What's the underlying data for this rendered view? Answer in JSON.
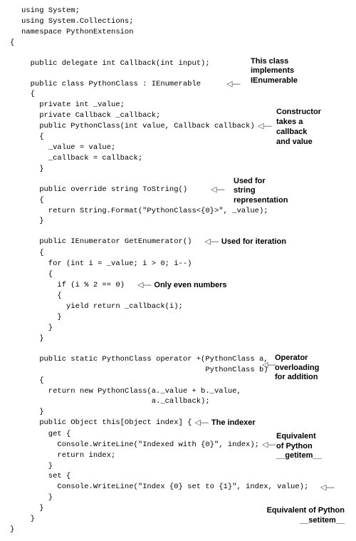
{
  "code": {
    "l01": "using System;",
    "l02": "using System.Collections;",
    "l03": "namespace PythonExtension",
    "l04": "{",
    "l05": "",
    "l06": "  public delegate int Callback(int input);",
    "l07": "",
    "l08": "  public class PythonClass : IEnumerable",
    "l09": "  {",
    "l10": "    private int _value;",
    "l11": "    private Callback _callback;",
    "l12": "    public PythonClass(int value, Callback callback)",
    "l13": "    {",
    "l14": "      _value = value;",
    "l15": "      _callback = callback;",
    "l16": "    }",
    "l17": "",
    "l18": "    public override string ToString()",
    "l19": "    {",
    "l20": "      return String.Format(\"PythonClass<{0}>\", _value);",
    "l21": "    }",
    "l22": "",
    "l23": "    public IEnumerator GetEnumerator()",
    "l24": "    {",
    "l25": "      for (int i = _value; i > 0; i--)",
    "l26": "      {",
    "l27": "        if (i % 2 == 0)",
    "l28": "        {",
    "l29": "          yield return _callback(i);",
    "l30": "        }",
    "l31": "      }",
    "l32": "    }",
    "l33": "",
    "l34": "    public static PythonClass operator +(PythonClass a,",
    "l35": "                                         PythonClass b)",
    "l36": "    {",
    "l37": "      return new PythonClass(a._value + b._value,",
    "l38": "                             a._callback);",
    "l39": "    }",
    "l40": "    public Object this[Object index] {",
    "l41": "      get {",
    "l42": "        Console.WriteLine(\"Indexed with {0}\", index);",
    "l43": "        return index;",
    "l44": "      }",
    "l45": "      set {",
    "l46": "        Console.WriteLine(\"Index {0} set to {1}\", index, value);",
    "l47": "      }",
    "l48": "    }",
    "l49": "  }",
    "l50": "}"
  },
  "ann": {
    "a1a": "This class implements",
    "a1b": "IEnumerable",
    "a2a": "Constructor takes a",
    "a2b": "callback and value",
    "a3a": "Used for string",
    "a3b": "representation",
    "a4": "Used for iteration",
    "a5": "Only even numbers",
    "a6a": "Operator overloading",
    "a6b": "for addition",
    "a7": "The indexer",
    "a8a": "Equivalent of Python",
    "a8b": "__getitem__",
    "a9a": "Equivalent of Python",
    "a9b": "__setitem__"
  },
  "arrow": "◁—"
}
